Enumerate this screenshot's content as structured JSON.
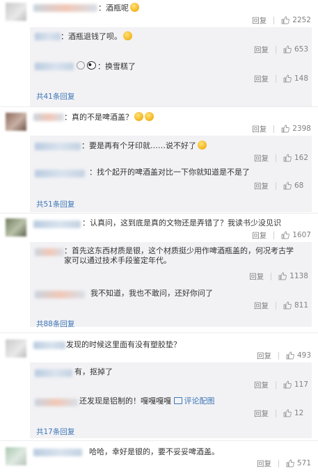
{
  "actions": {
    "reply": "回复"
  },
  "threads": [
    {
      "comment": {
        "text": "：酒瓶呢",
        "likes": "2252"
      },
      "replies": [
        {
          "text": "：酒瓶退钱了呗。",
          "likes": "653"
        },
        {
          "text": "：换雪糕了",
          "likes": "148"
        }
      ],
      "more": "共41条回复"
    },
    {
      "comment": {
        "text": "：真的不是啤酒盖？",
        "likes": "2398"
      },
      "replies": [
        {
          "text": "：要是再有个牙印就……说不好了",
          "likes": "162"
        },
        {
          "text": "：找个起开的啤酒盖对比一下你就知道是不是了",
          "likes": "68"
        }
      ],
      "more": "共51条回复"
    },
    {
      "comment": {
        "text": "：认真问，这到底是真的文物还是弄错了？我读书少没见识",
        "likes": "1607"
      },
      "replies": [
        {
          "text": "：首先这东西材质是银，这个材质挺少用作啤酒瓶盖的，何况考古学家可以通过技术手段鉴定年代。",
          "likes": "1138"
        },
        {
          "text": "我不知道，我也不敢问，还好你问了",
          "likes": "811"
        }
      ],
      "more": "共88条回复"
    },
    {
      "comment": {
        "text": "发现的时候这里面有没有塑胶垫？",
        "likes": "493"
      },
      "replies": [
        {
          "text": "有，抠掉了",
          "likes": "117"
        },
        {
          "text": "还发现是铝制的！嘎嘎嘎嘎",
          "image_link": "评论配图",
          "likes": "12"
        }
      ],
      "more": "共17条回复"
    },
    {
      "comment": {
        "text": "哈哈，幸好是银的，要不妥妥啤酒盖。",
        "likes": "571"
      },
      "replies": [],
      "more": ""
    }
  ]
}
